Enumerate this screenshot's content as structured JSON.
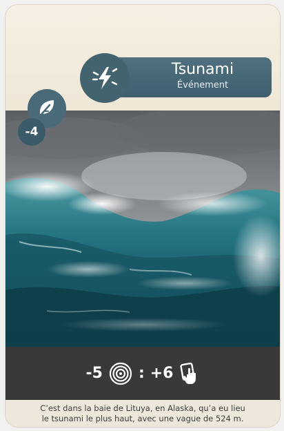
{
  "card": {
    "title": "Tsunami",
    "subtitle": "Événement",
    "type_icon": "lightning-icon",
    "badge_icon": "leaf-icon",
    "cost": "-4",
    "effect": {
      "left_value": "-5",
      "left_icon": "target-rings-icon",
      "separator": ":",
      "right_value": "+6",
      "right_icon": "card-hand-icon"
    },
    "flavor_line1": "C’est dans la baie de Lituya, en Alaska, qu’a eu lieu",
    "flavor_line2": "le tsunami le plus haut, avec une vague de 524 m."
  },
  "colors": {
    "title_pill": "#3e5f6f",
    "leaf_badge": "#4a6a79",
    "effect_band": "#3a3937",
    "card_bg": "#f4ede0"
  }
}
